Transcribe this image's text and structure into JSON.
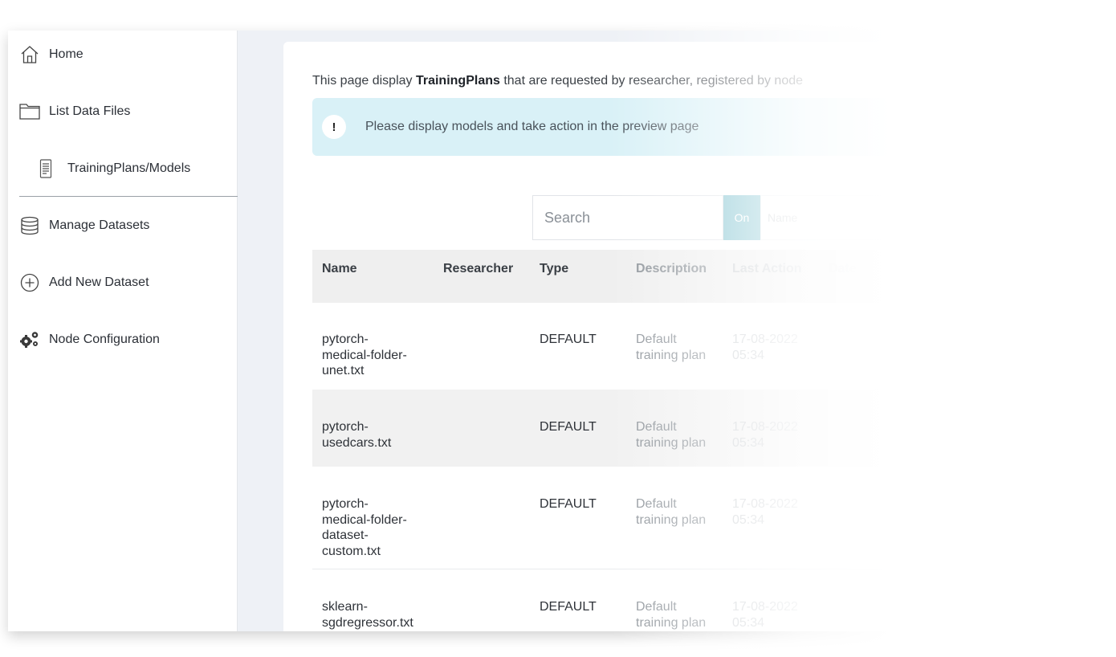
{
  "sidebar": {
    "items": [
      {
        "label": "Home",
        "icon": "home-icon"
      },
      {
        "label": "List Data Files",
        "icon": "folder-icon"
      },
      {
        "label": "TrainingPlans/Models",
        "icon": "document-icon"
      },
      {
        "label": "Manage Datasets",
        "icon": "database-icon"
      },
      {
        "label": "Add New Dataset",
        "icon": "plus-circle-icon"
      },
      {
        "label": "Node Configuration",
        "icon": "gears-icon"
      }
    ]
  },
  "main": {
    "intro_prefix": "This page display ",
    "intro_bold": "TrainingPlans",
    "intro_suffix": " that are requested by researcher, registered by node",
    "alert": {
      "badge": "!",
      "message": "Please display models and take action in the preview page"
    },
    "search": {
      "placeholder": "Search",
      "on_label": "On",
      "field_label": "Name"
    },
    "table": {
      "headers": [
        "Name",
        "Researcher",
        "Type",
        "Description",
        "Last Action",
        "Date"
      ],
      "rows": [
        {
          "name": [
            "pytorch-",
            "medical-folder-",
            "unet.txt"
          ],
          "researcher": "",
          "type": "DEFAULT",
          "description": [
            "Default",
            "training plan"
          ],
          "last_action": [
            "17-08-2022",
            "05:34"
          ]
        },
        {
          "name": [
            "pytorch-",
            "usedcars.txt"
          ],
          "researcher": "",
          "type": "DEFAULT",
          "description": [
            "Default",
            "training plan"
          ],
          "last_action": [
            "17-08-2022",
            "05:34"
          ]
        },
        {
          "name": [
            "pytorch-",
            "medical-folder-",
            "dataset-",
            "custom.txt"
          ],
          "researcher": "",
          "type": "DEFAULT",
          "description": [
            "Default",
            "training plan"
          ],
          "last_action": [
            "17-08-2022",
            "05:34"
          ]
        },
        {
          "name": [
            "sklearn-",
            "sgdregressor.txt"
          ],
          "researcher": "",
          "type": "DEFAULT",
          "description": [
            "Default",
            "training plan"
          ],
          "last_action": [
            "17-08-2022",
            "05:34"
          ]
        }
      ]
    }
  },
  "colors": {
    "accent": "#7fc2cf",
    "alert_bg": "#d9f1f7",
    "header_bg": "#efefef"
  }
}
